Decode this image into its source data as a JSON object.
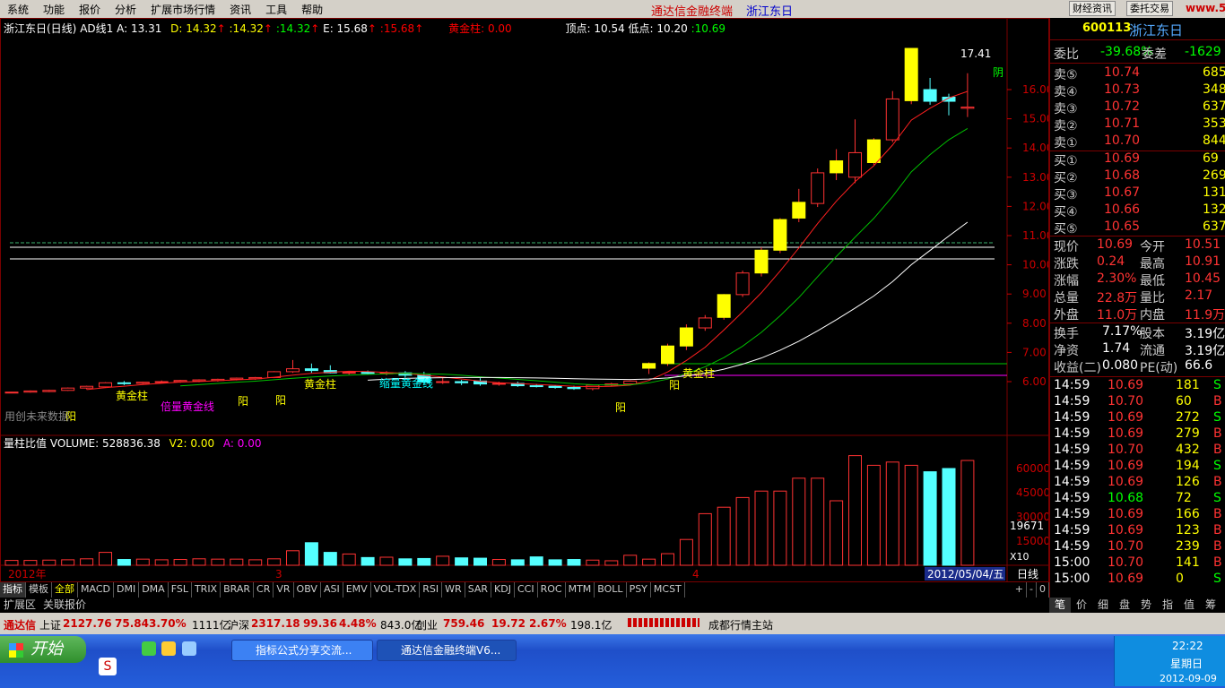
{
  "menu": [
    "系统",
    "功能",
    "报价",
    "分析",
    "扩展市场行情",
    "资讯",
    "工具",
    "帮助"
  ],
  "app_title": "通达信金融终端",
  "stock_title": "浙江东日",
  "toolbar": {
    "btn1": "财经资讯",
    "btn2": "委托交易"
  },
  "logo": "www.55188.com",
  "info": {
    "name": "浙江东日(日线)",
    "ind": "AD线1",
    "a": "A: 13.31",
    "d": "D: 14.32",
    "v2": ":14.32",
    "v3": ":14.32",
    "e": "E: 15.68",
    "v5": ":15.68",
    "gold": "黄金柱: 0.00",
    "top": "顶点: 10.54",
    "low": "低点: 10.20",
    "last": ":10.69"
  },
  "price_axis": [
    "16.00",
    "15.00",
    "14.00",
    "13.00",
    "12.00",
    "11.00",
    "10.00",
    "9.00",
    "8.00",
    "7.00",
    "6.00"
  ],
  "vol_axis": [
    "60000",
    "45000",
    "30000",
    "15000"
  ],
  "vol_badge": "19671",
  "x10": "X10",
  "annotations": {
    "a1": "黄金柱",
    "a2": "倍量黄金线",
    "a3": "阳",
    "a4": "黄金柱",
    "a5": "缩量黄金线",
    "a6": "阳",
    "a7": "阳",
    "a8": "黄金柱",
    "a9": "阳",
    "a10": "阳",
    "a11": "阴",
    "a12": "用创未来数据",
    "a13": "17.41"
  },
  "vol_info": {
    "title": "量柱比值",
    "vol": "VOLUME: 528836.38",
    "v2": "V2: 0.00",
    "a": "A: 0.00"
  },
  "months": {
    "m1": "2012年",
    "m2": "3",
    "m3": "4"
  },
  "date_badge": "2012/05/04/五",
  "period": "日线",
  "candles": [
    [
      5.62,
      5.65,
      5.6,
      5.64
    ],
    [
      5.64,
      5.7,
      5.62,
      5.68
    ],
    [
      5.66,
      5.72,
      5.64,
      5.7
    ],
    [
      5.7,
      5.8,
      5.68,
      5.78
    ],
    [
      5.78,
      5.86,
      5.74,
      5.84
    ],
    [
      5.82,
      5.98,
      5.8,
      5.96
    ],
    [
      5.96,
      6.02,
      5.88,
      5.94
    ],
    [
      5.94,
      6.0,
      5.9,
      5.98
    ],
    [
      5.98,
      6.04,
      5.94,
      6.0
    ],
    [
      6.0,
      6.06,
      5.96,
      6.04
    ],
    [
      6.02,
      6.08,
      5.98,
      6.06
    ],
    [
      6.04,
      6.1,
      6.0,
      6.08
    ],
    [
      6.08,
      6.14,
      6.04,
      6.12
    ],
    [
      6.1,
      6.16,
      6.06,
      6.14
    ],
    [
      6.14,
      6.36,
      6.12,
      6.34
    ],
    [
      6.34,
      6.74,
      6.3,
      6.44
    ],
    [
      6.44,
      6.62,
      6.3,
      6.38
    ],
    [
      6.38,
      6.56,
      6.28,
      6.3
    ],
    [
      6.3,
      6.36,
      6.24,
      6.32
    ],
    [
      6.32,
      6.38,
      6.26,
      6.28
    ],
    [
      6.28,
      6.36,
      6.22,
      6.3
    ],
    [
      6.3,
      6.36,
      6.14,
      6.22
    ],
    [
      6.22,
      6.34,
      5.92,
      5.98
    ],
    [
      5.98,
      6.14,
      5.92,
      6.0
    ],
    [
      6.0,
      6.06,
      5.88,
      5.96
    ],
    [
      6.02,
      6.12,
      5.86,
      5.92
    ],
    [
      5.92,
      6.0,
      5.86,
      5.94
    ],
    [
      5.94,
      6.0,
      5.82,
      5.86
    ],
    [
      5.86,
      5.92,
      5.8,
      5.84
    ],
    [
      5.84,
      5.88,
      5.76,
      5.8
    ],
    [
      5.8,
      5.86,
      5.72,
      5.76
    ],
    [
      5.76,
      5.9,
      5.7,
      5.88
    ],
    [
      5.88,
      5.96,
      5.84,
      5.92
    ],
    [
      5.92,
      6.04,
      5.9,
      6.02
    ],
    [
      6.46,
      6.66,
      6.26,
      6.62
    ],
    [
      6.62,
      7.3,
      6.54,
      7.22
    ],
    [
      7.22,
      7.96,
      7.08,
      7.84
    ],
    [
      7.84,
      8.28,
      7.74,
      8.18
    ],
    [
      8.2,
      9.0,
      8.12,
      8.98
    ],
    [
      8.98,
      9.8,
      8.9,
      9.72
    ],
    [
      9.72,
      10.6,
      9.6,
      10.5
    ],
    [
      10.5,
      11.6,
      10.4,
      11.55
    ],
    [
      11.6,
      12.6,
      11.46,
      12.14
    ],
    [
      12.1,
      13.3,
      11.98,
      13.15
    ],
    [
      13.15,
      13.96,
      12.9,
      13.56
    ],
    [
      13.0,
      14.98,
      12.8,
      13.84
    ],
    [
      13.5,
      14.34,
      13.42,
      14.28
    ],
    [
      14.28,
      15.95,
      14.2,
      15.68
    ],
    [
      15.62,
      17.41,
      15.5,
      17.41
    ],
    [
      16.0,
      16.4,
      15.48,
      15.6
    ],
    [
      15.74,
      15.86,
      15.12,
      15.6
    ],
    [
      15.36,
      16.56,
      15.06,
      15.4
    ]
  ],
  "volumes": [
    3000,
    3000,
    3200,
    3400,
    4000,
    8000,
    3600,
    3800,
    3400,
    3600,
    4000,
    3800,
    3800,
    3400,
    4000,
    9000,
    14000,
    8000,
    7000,
    4800,
    5000,
    4000,
    4200,
    5600,
    4600,
    4400,
    3600,
    3400,
    5200,
    3400,
    3600,
    3200,
    2800,
    6200,
    3800,
    7200,
    16000,
    32000,
    36000,
    42000,
    46000,
    46000,
    54000,
    54000,
    40000,
    68000,
    62000,
    64000,
    62000,
    58000,
    60000,
    65000,
    66000,
    56000,
    54000
  ],
  "quote": {
    "wei_bi": {
      "label": "委比",
      "val": "-39.68%",
      "label2": "委差",
      "val2": "-1629"
    },
    "sells": [
      {
        "l": "卖⑤",
        "p": "10.74",
        "v": "685"
      },
      {
        "l": "卖④",
        "p": "10.73",
        "v": "348"
      },
      {
        "l": "卖③",
        "p": "10.72",
        "v": "637"
      },
      {
        "l": "卖②",
        "p": "10.71",
        "v": "353"
      },
      {
        "l": "卖①",
        "p": "10.70",
        "v": "844"
      }
    ],
    "buys": [
      {
        "l": "买①",
        "p": "10.69",
        "v": "69"
      },
      {
        "l": "买②",
        "p": "10.68",
        "v": "269"
      },
      {
        "l": "买③",
        "p": "10.67",
        "v": "131"
      },
      {
        "l": "买④",
        "p": "10.66",
        "v": "132"
      },
      {
        "l": "买⑤",
        "p": "10.65",
        "v": "637"
      }
    ],
    "stats": [
      {
        "l1": "现价",
        "v1": "10.69",
        "l2": "今开",
        "v2": "10.51"
      },
      {
        "l1": "涨跌",
        "v1": "0.24",
        "l2": "最高",
        "v2": "10.91"
      },
      {
        "l1": "涨幅",
        "v1": "2.30%",
        "l2": "最低",
        "v2": "10.45"
      },
      {
        "l1": "总量",
        "v1": "22.8万",
        "l2": "量比",
        "v2": "2.17"
      },
      {
        "l1": "外盘",
        "v1": "11.0万",
        "l2": "内盘",
        "v2": "11.9万"
      }
    ],
    "stats2": [
      {
        "l1": "换手",
        "v1": "7.17%",
        "l2": "股本",
        "v2": "3.19亿"
      },
      {
        "l1": "净资",
        "v1": "1.74",
        "l2": "流通",
        "v2": "3.19亿"
      },
      {
        "l1": "收益(二)",
        "v1": "0.080",
        "l2": "PE(动)",
        "v2": "66.6"
      }
    ],
    "ticks": [
      {
        "t": "14:59",
        "p": "10.69",
        "v": "181",
        "s": "S"
      },
      {
        "t": "14:59",
        "p": "10.70",
        "v": "60",
        "s": "B"
      },
      {
        "t": "14:59",
        "p": "10.69",
        "v": "272",
        "s": "S"
      },
      {
        "t": "14:59",
        "p": "10.69",
        "v": "279",
        "s": "B"
      },
      {
        "t": "14:59",
        "p": "10.70",
        "v": "432",
        "s": "B"
      },
      {
        "t": "14:59",
        "p": "10.69",
        "v": "194",
        "s": "S"
      },
      {
        "t": "14:59",
        "p": "10.69",
        "v": "126",
        "s": "B"
      },
      {
        "t": "14:59",
        "p": "10.68",
        "v": "72",
        "s": "S"
      },
      {
        "t": "14:59",
        "p": "10.69",
        "v": "166",
        "s": "B"
      },
      {
        "t": "14:59",
        "p": "10.69",
        "v": "123",
        "s": "B"
      },
      {
        "t": "14:59",
        "p": "10.70",
        "v": "239",
        "s": "B"
      },
      {
        "t": "15:00",
        "p": "10.70",
        "v": "141",
        "s": "B"
      },
      {
        "t": "15:00",
        "p": "10.69",
        "v": "0",
        "s": "S"
      }
    ],
    "code": "600113",
    "name": "浙江东日"
  },
  "tabs": [
    "指标",
    "模板",
    "全部",
    "MACD",
    "DMI",
    "DMA",
    "FSL",
    "TRIX",
    "BRAR",
    "CR",
    "VR",
    "OBV",
    "ASI",
    "EMV",
    "VOL-TDX",
    "RSI",
    "WR",
    "SAR",
    "KDJ",
    "CCI",
    "ROC",
    "MTM",
    "BOLL",
    "PSY",
    "MCST"
  ],
  "tab_ctrl": [
    "+",
    "-",
    "0"
  ],
  "extra_tabs": [
    "扩展区",
    "关联报价"
  ],
  "rtabs": [
    "笔",
    "价",
    "细",
    "盘",
    "势",
    "指",
    "值",
    "筹"
  ],
  "status": {
    "brand": "通达信",
    "sh": "上证",
    "sh_v": "2127.76",
    "sh_c": "75.84",
    "sh_p": "3.70%",
    "sh_a": "1111亿",
    "hs": "沪深",
    "hs_v": "2317.18",
    "hs_c": "99.36",
    "hs_p": "4.48%",
    "hs_a": "843.0亿",
    "cy": "创业",
    "cy_v": "759.46",
    "cy_c": "19.72",
    "cy_p": "2.67%",
    "cy_a": "198.1亿",
    "server": "成都行情主站"
  },
  "taskbar": {
    "start": "开始",
    "item1": "指标公式分享交流...",
    "item2": "通达信金融终端V6...",
    "time": "22:22",
    "weekday": "星期日",
    "date": "2012-09-09"
  },
  "colors": {
    "up": "#ff3232",
    "down": "#54ffff",
    "yellow": "#ffff00",
    "ma1": "#ffffff",
    "ma2": "#00c000"
  }
}
